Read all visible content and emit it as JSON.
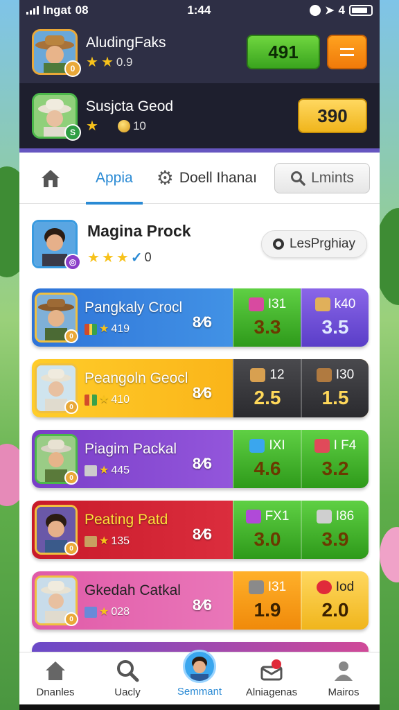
{
  "status": {
    "carrier": "Ingat",
    "network": "08",
    "time": "1:44",
    "right_text": "4"
  },
  "header": {
    "player1": {
      "name": "AludingFaks",
      "sub": "0.9",
      "score": "491",
      "avatar_icon": "cowboy-hat-avatar",
      "menu_icon": "menu-icon"
    },
    "player2": {
      "name": "Susjcta Geod",
      "sub": "10",
      "score": "390",
      "avatar_icon": "safari-hat-avatar"
    }
  },
  "tabs": {
    "active": "Appia",
    "settings": "Doell Ihanaı",
    "search_button": "Lmints"
  },
  "profile": {
    "name": "Magina Prock",
    "sub": "0",
    "pill": "LesPrghiay"
  },
  "rows": [
    {
      "title": "Pangkaly Crocl",
      "sub": "419",
      "pct": "8⁄6",
      "s1_label": "I31",
      "s1_value": "3.3",
      "s2_label": "k40",
      "s2_value": "3.5"
    },
    {
      "title": "Peangoln Geocl",
      "sub": "410",
      "pct": "8⁄6",
      "s1_label": "12",
      "s1_value": "2.5",
      "s2_label": "I30",
      "s2_value": "1.5"
    },
    {
      "title": "Piagim Packal",
      "sub": "445",
      "pct": "8⁄6",
      "s1_label": "IXI",
      "s1_value": "4.6",
      "s2_label": "I F4",
      "s2_value": "3.2"
    },
    {
      "title": "Peating Patd",
      "sub": "135",
      "pct": "8⁄6",
      "s1_label": "FX1",
      "s1_value": "3.0",
      "s2_label": "I86",
      "s2_value": "3.9"
    },
    {
      "title": "Gkedah Catkal",
      "sub": "028",
      "pct": "8⁄6",
      "s1_label": "I31",
      "s1_value": "1.9",
      "s2_label": "Iod",
      "s2_value": "2.0"
    }
  ],
  "nav": {
    "items": [
      "Dnanles",
      "Uacly",
      "Semmant",
      "Alniagenas",
      "Mairos"
    ],
    "active_index": 2
  },
  "colors": {
    "accent": "#2a8ad4",
    "header_bg": "#2e2f45",
    "green": "#3aa41e",
    "orange": "#f07a0a",
    "yellow": "#f0b51c"
  }
}
